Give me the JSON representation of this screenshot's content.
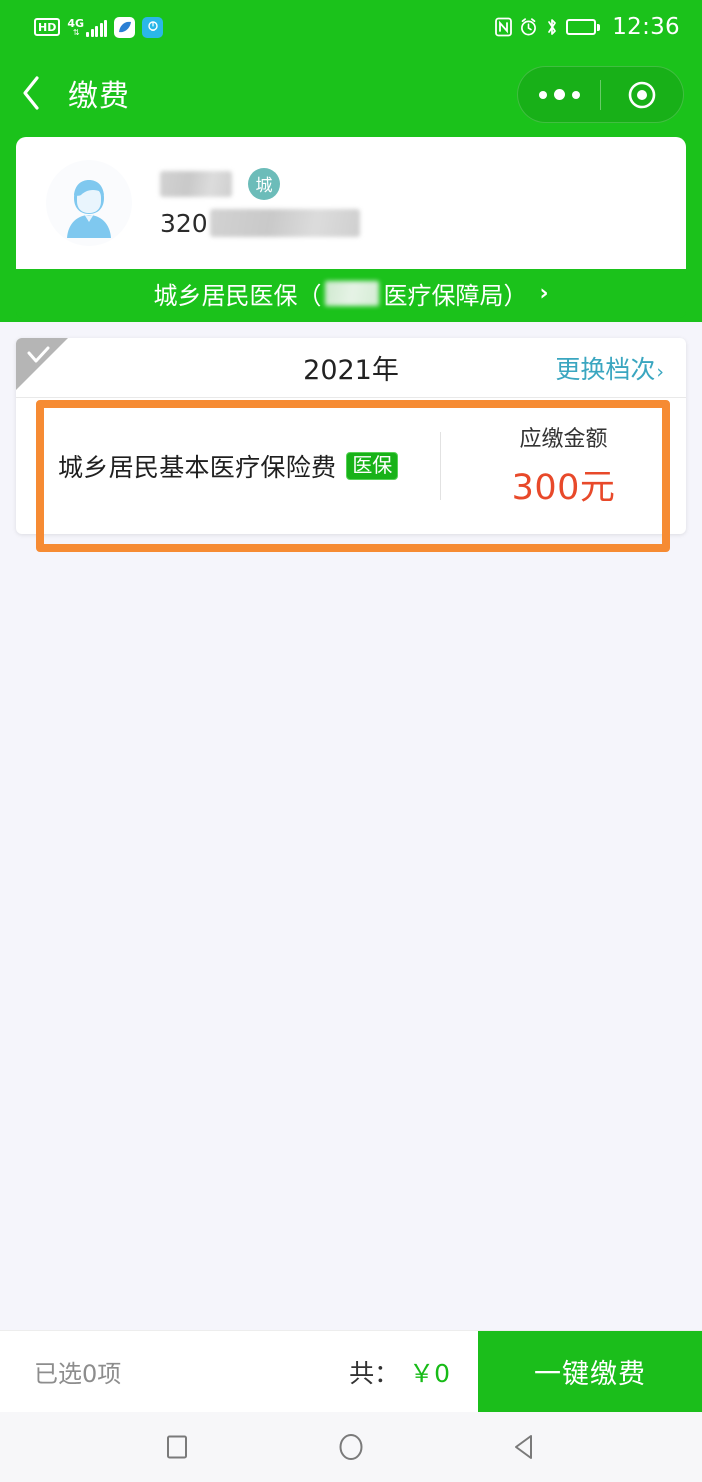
{
  "status_bar": {
    "hd_label": "HD",
    "network_label": "4G",
    "network_arrows": "⇵",
    "icons": [
      "hd-badge",
      "signal-bars-icon",
      "app-icon",
      "bulb-icon",
      "nfc-icon",
      "alarm-icon",
      "bluetooth-icon",
      "battery-icon"
    ],
    "time": "12:36"
  },
  "nav": {
    "back_icon": "chevron-left-icon",
    "title": "缴费",
    "capsule": {
      "more_icon": "more-dots-icon",
      "target_icon": "target-circle-icon"
    }
  },
  "user_card": {
    "avatar_icon": "person-avatar",
    "name": "",
    "name_redacted": true,
    "badge": "城",
    "id_prefix": "320",
    "id_redacted": true
  },
  "insurance_banner": {
    "text_before": "城乡居民医保（",
    "org_redacted": true,
    "text_after": "医疗保障局）",
    "chevron": "›"
  },
  "pay_card": {
    "selected": false,
    "check_icon": "check-icon",
    "year": "2021年",
    "change_tier_label": "更换档次",
    "change_tier_chevron": "›",
    "fee_name": "城乡居民基本医疗保险费",
    "fee_badge": "医保",
    "amount_label": "应缴金额",
    "amount_value": "300元",
    "highlight_color": "#f68b33"
  },
  "bottom_bar": {
    "selected_count_label": "已选0项",
    "total_label": "共：",
    "total_value": "￥0",
    "pay_button_label": "一键缴费"
  },
  "android_nav": {
    "recents_icon": "square-recents-icon",
    "home_icon": "circle-home-icon",
    "back_icon": "triangle-back-icon"
  },
  "colors": {
    "brand_green": "#1bc21b",
    "page_bg": "#f5f5fb",
    "amount_red": "#e8492a",
    "link_teal": "#3aa6c0",
    "highlight_orange": "#f68b33"
  }
}
